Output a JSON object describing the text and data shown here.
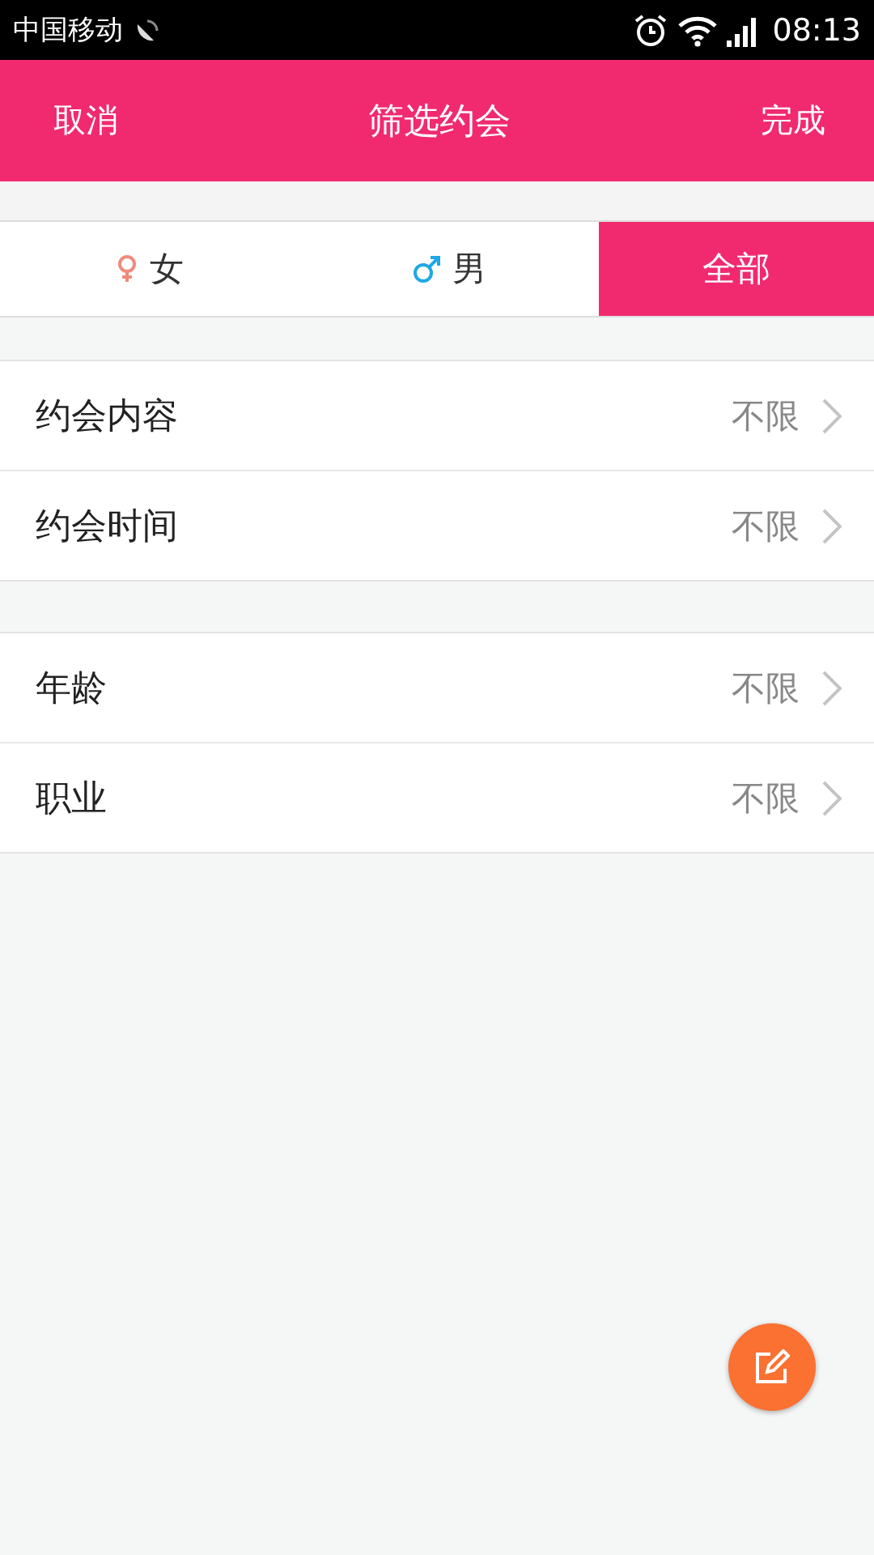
{
  "status_bar": {
    "carrier": "中国移动",
    "time": "08:13"
  },
  "header": {
    "cancel": "取消",
    "title": "筛选约会",
    "done": "完成"
  },
  "tabs": [
    {
      "kind": "female",
      "label": "女",
      "selected": false
    },
    {
      "kind": "male",
      "label": "男",
      "selected": false
    },
    {
      "kind": "all",
      "label": "全部",
      "selected": true
    }
  ],
  "groups": [
    {
      "rows": [
        {
          "label": "约会内容",
          "value": "不限"
        },
        {
          "label": "约会时间",
          "value": "不限"
        }
      ]
    },
    {
      "rows": [
        {
          "label": "年龄",
          "value": "不限"
        },
        {
          "label": "职业",
          "value": "不限"
        }
      ]
    }
  ]
}
